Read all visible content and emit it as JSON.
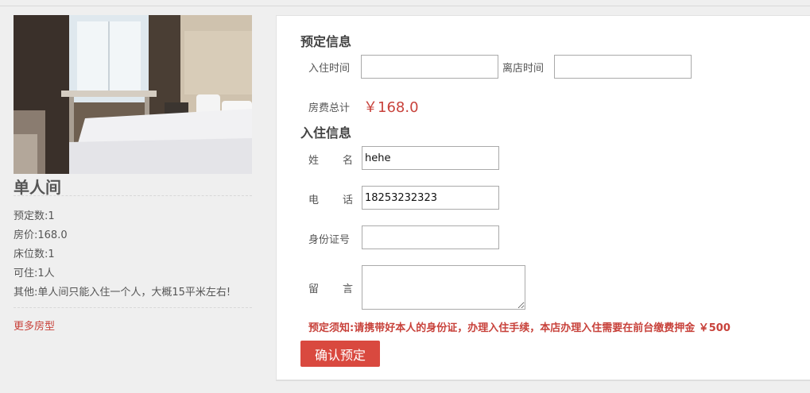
{
  "room": {
    "name": "单人间",
    "reservations": "预定数:1",
    "price": "房价:168.0",
    "beds": "床位数:1",
    "capacity": "可住:1人",
    "other": "其他:单人间只能入住一个人，大概15平米左右!",
    "more_link": "更多房型"
  },
  "booking": {
    "title": "预定信息",
    "checkin_label": "入住时间",
    "checkin_value": "",
    "checkout_label": "离店时间",
    "checkout_value": "",
    "total_label": "房费总计",
    "total_value": "￥168.0"
  },
  "guest": {
    "title": "入住信息",
    "name_label": [
      "姓",
      "名"
    ],
    "name_value": "hehe",
    "phone_label": [
      "电",
      "话"
    ],
    "phone_value": "18253232323",
    "id_label": "身份证号",
    "id_value": "",
    "message_label": [
      "留",
      "言"
    ],
    "message_value": ""
  },
  "notice": "预定须知:请携带好本人的身份证，办理入住手续，本店办理入住需要在前台缴费押金 ￥500",
  "submit_label": "确认预定",
  "colors": {
    "accent": "#d9493f",
    "price": "#c8423b"
  }
}
